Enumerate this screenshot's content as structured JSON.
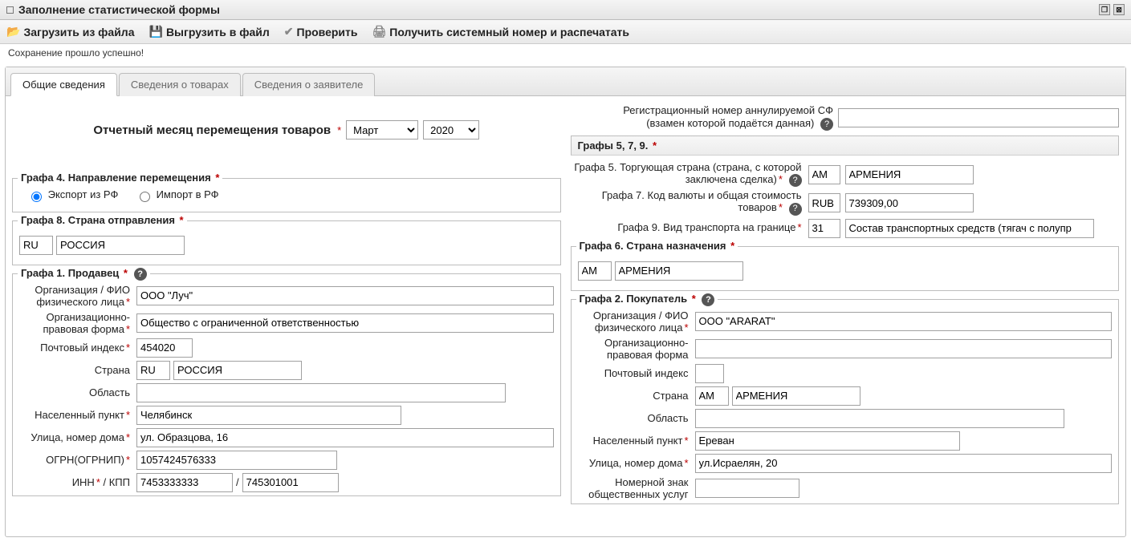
{
  "window": {
    "title": "Заполнение статистической формы"
  },
  "toolbar": {
    "load": "Загрузить из файла",
    "export": "Выгрузить в файл",
    "check": "Проверить",
    "print": "Получить системный номер и распечатать"
  },
  "status": "Сохранение прошло успешно!",
  "tabs": {
    "general": "Общие сведения",
    "goods": "Сведения о товарах",
    "applicant": "Сведения о заявителе"
  },
  "report_period": {
    "label": "Отчетный месяц перемещения товаров",
    "month": "Март",
    "year": "2020"
  },
  "reg_num": {
    "label_line1": "Регистрационный номер аннулируемой СФ",
    "label_line2": "(взамен которой подаётся данная)",
    "value": ""
  },
  "g579_header": "Графы 5, 7, 9.",
  "g5": {
    "label": "Графа 5. Торгующая страна (страна, с которой заключена сделка)",
    "code": "AM",
    "name": "АРМЕНИЯ"
  },
  "g7": {
    "label": "Графа 7. Код валюты и общая стоимость товаров",
    "code": "RUB",
    "amount": "739309,00"
  },
  "g9": {
    "label": "Графа 9. Вид транспорта на границе",
    "code": "31",
    "desc": "Состав транспортных средств (тягач с полупр"
  },
  "g4": {
    "legend": "Графа 4. Направление перемещения",
    "export_label": "Экспорт из РФ",
    "import_label": "Импорт в РФ",
    "selected": "export"
  },
  "g8": {
    "legend": "Графа 8. Страна отправления",
    "code": "RU",
    "name": "РОССИЯ"
  },
  "g6": {
    "legend": "Графа 6. Страна назначения",
    "code": "AM",
    "name": "АРМЕНИЯ"
  },
  "g1": {
    "legend": "Графа 1. Продавец",
    "org_label": "Организация / ФИО физического лица",
    "org": "ООО \"Луч\"",
    "form_label": "Организационно-правовая форма",
    "form": "Общество с ограниченной ответственностью",
    "zip_label": "Почтовый индекс",
    "zip": "454020",
    "country_label": "Страна",
    "country_code": "RU",
    "country_name": "РОССИЯ",
    "region_label": "Область",
    "region": "",
    "city_label": "Населенный пункт",
    "city": "Челябинск",
    "street_label": "Улица, номер дома",
    "street": "ул. Образцова, 16",
    "ogrn_label": "ОГРН(ОГРНИП)",
    "ogrn": "1057424576333",
    "inn_label": "ИНН",
    "kpp_label": "КПП",
    "inn_sep": " / ",
    "inn": "7453333333",
    "kpp": "745301001"
  },
  "g2": {
    "legend": "Графа 2. Покупатель",
    "org_label": "Организация / ФИО физического лица",
    "org": "ООО \"ARARAT\"",
    "form_label": "Организационно-правовая форма",
    "form": "",
    "zip_label": "Почтовый индекс",
    "zip": "",
    "country_label": "Страна",
    "country_code": "AM",
    "country_name": "АРМЕНИЯ",
    "region_label": "Область",
    "region": "",
    "city_label": "Населенный пункт",
    "city": "Ереван",
    "street_label": "Улица, номер дома",
    "street": "ул.Исраелян, 20",
    "nzou_label": "Номерной знак общественных услуг"
  }
}
